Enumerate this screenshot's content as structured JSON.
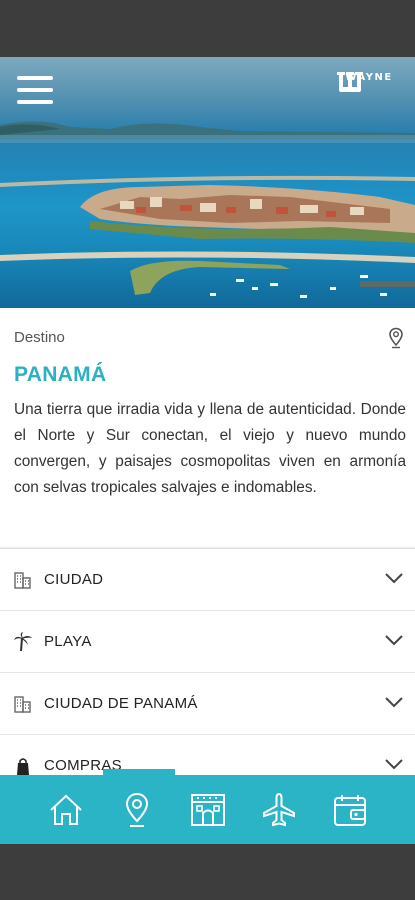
{
  "header": {
    "brand": "WAYNE",
    "menu_icon": "hamburger-menu-icon",
    "logo_icon": "wayne-logo-icon"
  },
  "destination": {
    "section_label": "Destino",
    "pin_icon": "map-pin-icon",
    "name": "PANAMÁ",
    "description": "Una tierra que irradia vida y llena de autenticidad. Donde el Norte y Sur conectan, el viejo y nuevo mundo convergen, y paisajes cosmopolitas viven en armonía con selvas tropicales salvajes e indomables."
  },
  "accordion": {
    "items": [
      {
        "label": "CIUDAD",
        "icon": "buildings-icon"
      },
      {
        "label": "PLAYA",
        "icon": "palm-tree-icon"
      },
      {
        "label": "CIUDAD DE PANAMÁ",
        "icon": "buildings-icon"
      },
      {
        "label": "COMPRAS",
        "icon": "shopping-bag-icon"
      }
    ]
  },
  "tabbar": {
    "tabs": [
      {
        "name": "home",
        "icon": "home-icon"
      },
      {
        "name": "location",
        "icon": "location-pin-icon"
      },
      {
        "name": "hotel",
        "icon": "hotel-icon"
      },
      {
        "name": "flights",
        "icon": "airplane-icon"
      },
      {
        "name": "bookings",
        "icon": "calendar-wallet-icon"
      }
    ]
  },
  "colors": {
    "accent": "#2bb3c6",
    "title": "#2bb0c4",
    "system_bars": "#3d3d3d"
  }
}
